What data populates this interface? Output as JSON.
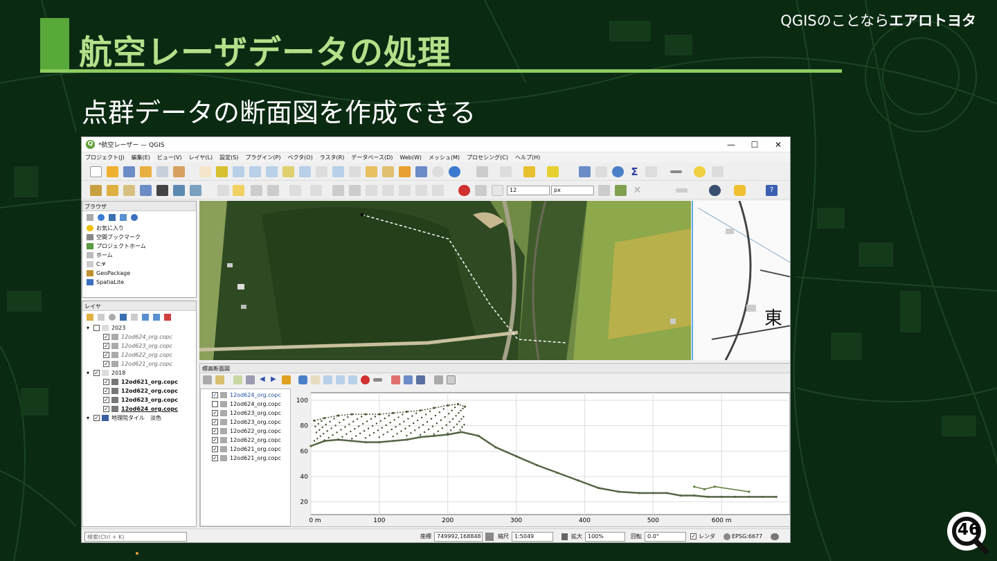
{
  "brand": {
    "light": "QGISのことなら",
    "bold": "エアロトヨタ"
  },
  "slide": {
    "title": "航空レーザデータの処理",
    "subtitle": "点群データの断面図を作成できる",
    "page": "46"
  },
  "window": {
    "title": "*航空レーザー — QGIS",
    "controls": [
      "—",
      "☐",
      "✕"
    ]
  },
  "menu": [
    "プロジェクト(J)",
    "編集(E)",
    "ビュー(V)",
    "レイヤ(L)",
    "設定(S)",
    "プラグイン(P)",
    "ベクタ(O)",
    "ラスタ(R)",
    "データベース(D)",
    "Web(W)",
    "メッシュ(M)",
    "プロセシング(C)",
    "ヘルプ(H)"
  ],
  "toolbar": {
    "size_value": "12",
    "unit_value": "px"
  },
  "browser": {
    "title": "ブラウザ",
    "items": [
      {
        "label": "お気に入り",
        "icon": "star-icon"
      },
      {
        "label": "空間ブックマーク",
        "icon": "bookmark-icon"
      },
      {
        "label": "プロジェクトホーム",
        "icon": "project-home-icon"
      },
      {
        "label": "ホーム",
        "icon": "home-icon"
      },
      {
        "label": "C:¥",
        "icon": "drive-icon"
      },
      {
        "label": "GeoPackage",
        "icon": "geopackage-icon"
      },
      {
        "label": "SpatiaLite",
        "icon": "spatialite-icon"
      }
    ]
  },
  "layers": {
    "title": "レイヤ",
    "groups": [
      {
        "name": "2023",
        "checked": false,
        "items": [
          {
            "label": "12od624_org.copc",
            "checked": true
          },
          {
            "label": "12od623_org.copc",
            "checked": true
          },
          {
            "label": "12od622_org.copc",
            "checked": true
          },
          {
            "label": "12od621_org.copc",
            "checked": true
          }
        ]
      },
      {
        "name": "2018",
        "checked": true,
        "items": [
          {
            "label": "12od621_org.copc",
            "checked": true
          },
          {
            "label": "12od622_org.copc",
            "checked": true
          },
          {
            "label": "12od623_org.copc",
            "checked": true
          },
          {
            "label": "12od624_org.copc",
            "checked": true
          }
        ]
      }
    ],
    "tile": {
      "label": "地理院タイル　淡色",
      "checked": true
    }
  },
  "map": {
    "label_text": "東"
  },
  "profile": {
    "title": "標高断面図",
    "layers": [
      {
        "label": "12od624_org.copc",
        "checked": true
      },
      {
        "label": "12od624_org.copc",
        "checked": false
      },
      {
        "label": "12od623_org.copc",
        "checked": true
      },
      {
        "label": "12od623_org.copc",
        "checked": true
      },
      {
        "label": "12od622_org.copc",
        "checked": true
      },
      {
        "label": "12od622_org.copc",
        "checked": true
      },
      {
        "label": "12od621_org.copc",
        "checked": true
      },
      {
        "label": "12od621_org.copc",
        "checked": true
      }
    ]
  },
  "chart_data": {
    "type": "scatter",
    "title": "",
    "xlabel": "",
    "ylabel": "",
    "x_ticks": [
      "0 m",
      "100",
      "200",
      "300",
      "400",
      "500",
      "600 m"
    ],
    "y_ticks": [
      "20",
      "40",
      "60",
      "80",
      "100"
    ],
    "xlim": [
      0,
      700
    ],
    "ylim": [
      10,
      106
    ],
    "grid": true,
    "series": [
      {
        "values": [
          [
            0,
            64
          ],
          [
            20,
            68
          ],
          [
            40,
            69
          ],
          [
            60,
            68
          ],
          [
            80,
            67
          ],
          [
            100,
            67
          ],
          [
            120,
            68
          ],
          [
            140,
            69
          ],
          [
            160,
            71
          ],
          [
            180,
            72
          ],
          [
            200,
            73
          ],
          [
            220,
            75
          ],
          [
            245,
            72
          ],
          [
            270,
            63
          ],
          [
            300,
            56
          ],
          [
            330,
            49
          ],
          [
            360,
            43
          ],
          [
            390,
            37
          ],
          [
            420,
            31
          ],
          [
            450,
            28
          ],
          [
            480,
            27
          ],
          [
            500,
            27
          ],
          [
            520,
            27
          ],
          [
            540,
            25
          ],
          [
            560,
            25
          ],
          [
            580,
            24
          ],
          [
            600,
            24
          ],
          [
            620,
            24
          ],
          [
            640,
            24
          ],
          [
            660,
            24
          ],
          [
            680,
            24
          ]
        ],
        "color": "#556644"
      },
      {
        "values": [
          [
            5,
            84
          ],
          [
            20,
            86
          ],
          [
            40,
            88
          ],
          [
            60,
            89
          ],
          [
            80,
            89
          ],
          [
            100,
            89
          ],
          [
            120,
            90
          ],
          [
            140,
            91
          ],
          [
            160,
            92
          ],
          [
            180,
            94
          ],
          [
            200,
            96
          ],
          [
            215,
            97
          ],
          [
            225,
            95
          ]
        ],
        "color": "#4a5a32"
      },
      {
        "values": [
          [
            560,
            32
          ],
          [
            575,
            30
          ],
          [
            590,
            32
          ],
          [
            640,
            28
          ]
        ],
        "color": "#5a7a3a"
      }
    ]
  },
  "status": {
    "search_placeholder": "検索(Ctrl + K)",
    "coord_label": "座標",
    "coord_value": "749992,168848",
    "scale_label": "縮尺",
    "scale_value": "1:5049",
    "zoom_label": "拡大",
    "zoom_value": "100%",
    "rotation_label": "回転",
    "rotation_value": "0.0°",
    "render_label": "レンダ",
    "crs": "EPSG:6677"
  }
}
